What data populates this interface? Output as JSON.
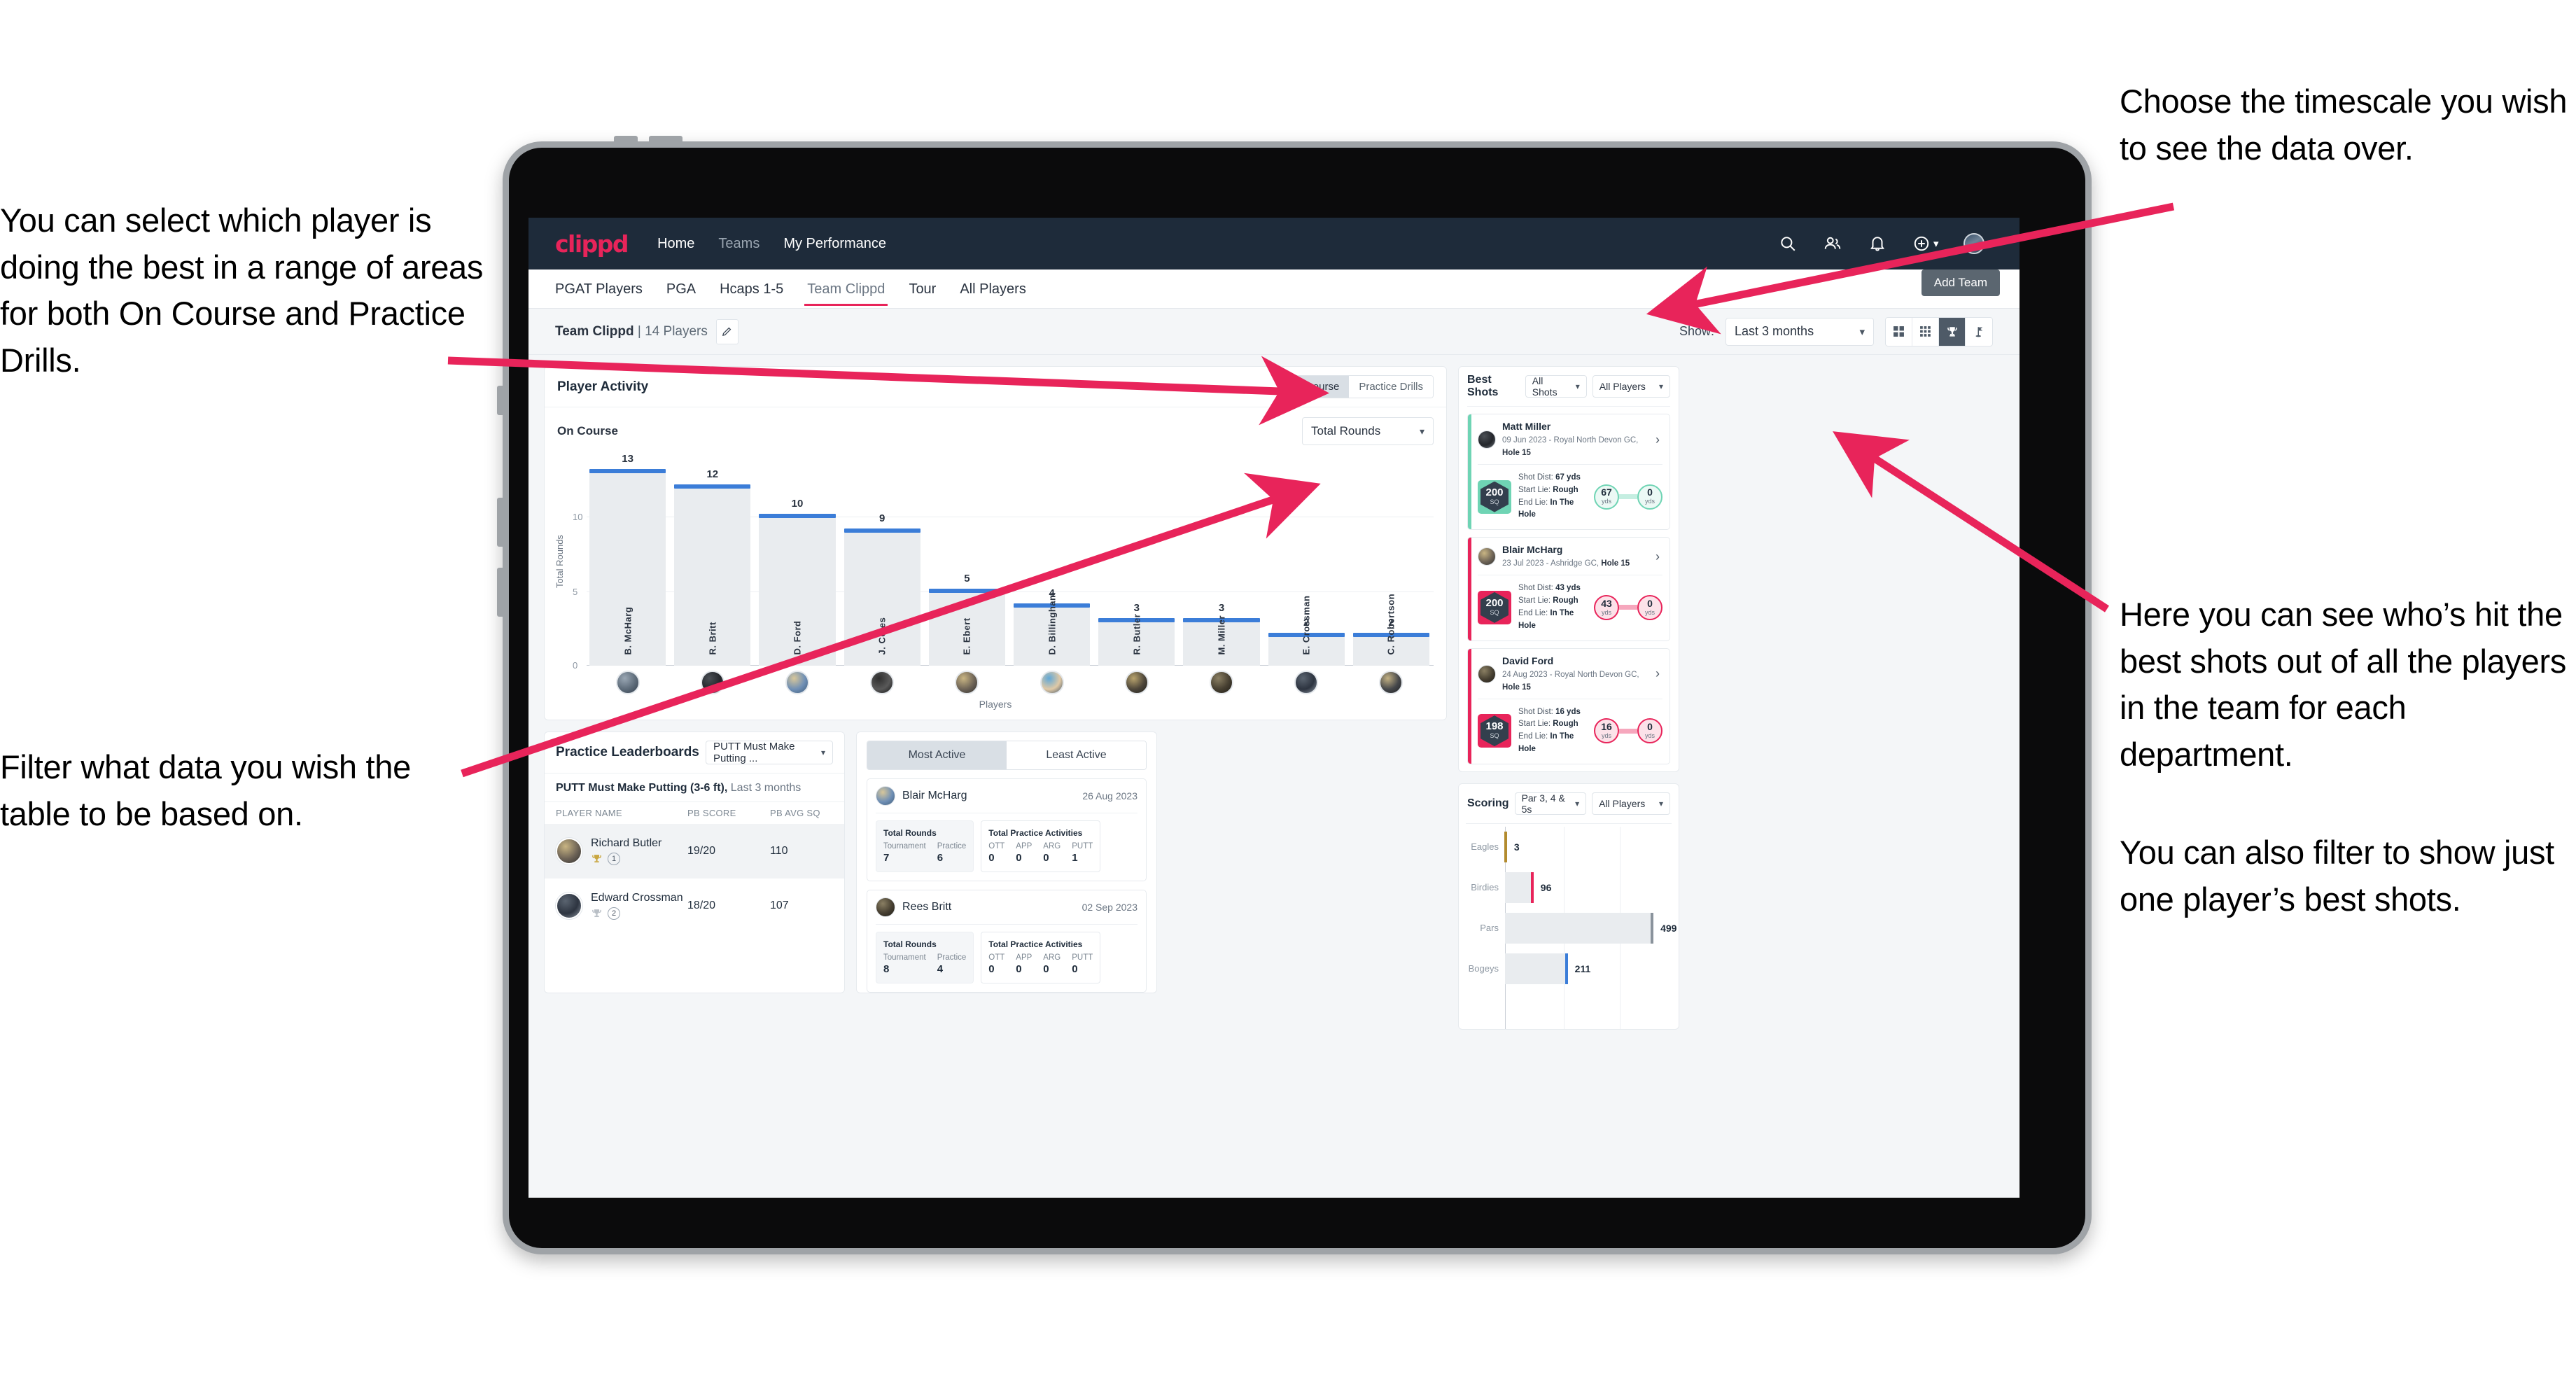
{
  "annotations": {
    "left_top": "You can select which player is doing the best in a range of areas for both On Course and Practice Drills.",
    "left_bottom": "Filter what data you wish the table to be based on.",
    "right_top": "Choose the timescale you wish to see the data over.",
    "right_middle": "Here you can see who’s hit the best shots out of all the players in the team for each department.",
    "right_bottom": "You can also filter to show just one player’s best shots."
  },
  "topnav": {
    "logo": "clippd",
    "links": [
      {
        "label": "Home",
        "active": true
      },
      {
        "label": "Teams",
        "active": false
      },
      {
        "label": "My Performance",
        "active": true
      }
    ],
    "icons": [
      "search-icon",
      "people-icon",
      "bell-icon",
      "plus-circle-icon",
      "avatar"
    ]
  },
  "tabs": [
    {
      "label": "PGAT Players",
      "active": false
    },
    {
      "label": "PGA",
      "active": false
    },
    {
      "label": "Hcaps 1-5",
      "active": false
    },
    {
      "label": "Team Clippd",
      "active": true
    },
    {
      "label": "Tour",
      "active": false
    },
    {
      "label": "All Players",
      "active": false
    }
  ],
  "tooltip": {
    "add_team": "Add Team"
  },
  "toolbar": {
    "team_name": "Team Clippd",
    "separator": "|",
    "player_count": "14 Players",
    "edit_icon": "pencil-icon",
    "show_label": "Show:",
    "timescale_value": "Last 3 months",
    "view_icons": [
      {
        "name": "grid-2x2-icon",
        "active": false
      },
      {
        "name": "grid-3x3-icon",
        "active": false
      },
      {
        "name": "trophy-icon",
        "active": true
      },
      {
        "name": "golf-flag-icon",
        "active": false
      }
    ]
  },
  "player_activity": {
    "title": "Player Activity",
    "segments": [
      {
        "label": "On Course",
        "active": true
      },
      {
        "label": "Practice Drills",
        "active": false
      }
    ],
    "sub_label": "On Course",
    "metric_value": "Total Rounds"
  },
  "chart_data": [
    {
      "type": "bar",
      "title": "Player Activity - On Course",
      "xlabel": "Players",
      "ylabel": "Total Rounds",
      "categories": [
        "B. McHarg",
        "R. Britt",
        "D. Ford",
        "J. Coles",
        "E. Ebert",
        "D. Billingham",
        "R. Butler",
        "M. Miller",
        "E. Crossman",
        "C. Robertson"
      ],
      "values": [
        13,
        12,
        10,
        9,
        5,
        4,
        3,
        3,
        2,
        2
      ],
      "yticks": [
        0,
        5,
        10
      ],
      "ylim": [
        0,
        14
      ],
      "grid": true,
      "bar_color": "#e9ecef",
      "cap_color": "#3b7dd8"
    },
    {
      "type": "bar",
      "orientation": "horizontal",
      "title": "Scoring",
      "categories": [
        "Eagles",
        "Birdies",
        "Pars",
        "Bogeys"
      ],
      "values": [
        3,
        96,
        499,
        211
      ],
      "xlim": [
        0,
        560
      ],
      "grid": true,
      "tip_colors": [
        "#b38b2e",
        "#e8245a",
        "#8a939c",
        "#3b7dd8"
      ],
      "bar_color": "#e9ecef"
    }
  ],
  "best_shots": {
    "title": "Best Shots",
    "shot_filter": "All Shots",
    "player_filter": "All Players",
    "cards": [
      {
        "player": "Matt Miller",
        "meta_prefix": "09 Jun 2023 - Royal North Devon GC, ",
        "meta_hole": "Hole 15",
        "badge_value": "200",
        "badge_unit": "SQ",
        "badge_color": "#6fd4b4",
        "accent": "#6fd4b4",
        "shot_dist_label": "Shot Dist: ",
        "shot_dist_value": "67 yds",
        "start_lie_label": "Start Lie: ",
        "start_lie_value": "Rough",
        "end_lie_label": "End Lie: ",
        "end_lie_value": "In The Hole",
        "from_value": "67",
        "from_unit": "yds",
        "to_value": "0",
        "to_unit": "yds"
      },
      {
        "player": "Blair McHarg",
        "meta_prefix": "23 Jul 2023 - Ashridge GC, ",
        "meta_hole": "Hole 15",
        "badge_value": "200",
        "badge_unit": "SQ",
        "badge_color": "#e8245a",
        "accent": "#e8245a",
        "shot_dist_label": "Shot Dist: ",
        "shot_dist_value": "43 yds",
        "start_lie_label": "Start Lie: ",
        "start_lie_value": "Rough",
        "end_lie_label": "End Lie: ",
        "end_lie_value": "In The Hole",
        "from_value": "43",
        "from_unit": "yds",
        "to_value": "0",
        "to_unit": "yds"
      },
      {
        "player": "David Ford",
        "meta_prefix": "24 Aug 2023 - Royal North Devon GC, ",
        "meta_hole": "Hole 15",
        "badge_value": "198",
        "badge_unit": "SQ",
        "badge_color": "#e8245a",
        "accent": "#e8245a",
        "shot_dist_label": "Shot Dist: ",
        "shot_dist_value": "16 yds",
        "start_lie_label": "Start Lie: ",
        "start_lie_value": "Rough",
        "end_lie_label": "End Lie: ",
        "end_lie_value": "In The Hole",
        "from_value": "16",
        "from_unit": "yds",
        "to_value": "0",
        "to_unit": "yds"
      }
    ]
  },
  "practice_leaderboards": {
    "title": "Practice Leaderboards",
    "drill_select": "PUTT Must Make Putting ...",
    "sub_bold": "PUTT Must Make Putting (3-6 ft),",
    "sub_light": " Last 3 months",
    "headers": [
      "PLAYER NAME",
      "PB SCORE",
      "PB AVG SQ"
    ],
    "rows": [
      {
        "name": "Richard Butler",
        "medal": "gold",
        "rank": "1",
        "pb_score": "19/20",
        "pb_avg_sq": "110",
        "highlight": true
      },
      {
        "name": "Edward Crossman",
        "medal": "silver",
        "rank": "2",
        "pb_score": "18/20",
        "pb_avg_sq": "107",
        "highlight": false
      }
    ]
  },
  "activity": {
    "tabs": [
      {
        "label": "Most Active",
        "active": true
      },
      {
        "label": "Least Active",
        "active": false
      }
    ],
    "cards": [
      {
        "player": "Blair McHarg",
        "date": "26 Aug 2023",
        "rounds_title": "Total Rounds",
        "rounds": [
          {
            "k": "Tournament",
            "v": "7"
          },
          {
            "k": "Practice",
            "v": "6"
          }
        ],
        "practice_title": "Total Practice Activities",
        "practice": [
          {
            "k": "OTT",
            "v": "0"
          },
          {
            "k": "APP",
            "v": "0"
          },
          {
            "k": "ARG",
            "v": "0"
          },
          {
            "k": "PUTT",
            "v": "1"
          }
        ]
      },
      {
        "player": "Rees Britt",
        "date": "02 Sep 2023",
        "rounds_title": "Total Rounds",
        "rounds": [
          {
            "k": "Tournament",
            "v": "8"
          },
          {
            "k": "Practice",
            "v": "4"
          }
        ],
        "practice_title": "Total Practice Activities",
        "practice": [
          {
            "k": "OTT",
            "v": "0"
          },
          {
            "k": "APP",
            "v": "0"
          },
          {
            "k": "ARG",
            "v": "0"
          },
          {
            "k": "PUTT",
            "v": "0"
          }
        ]
      }
    ]
  },
  "scoring": {
    "title": "Scoring",
    "par_filter": "Par 3, 4 & 5s",
    "player_filter": "All Players"
  },
  "colors": {
    "brand_pink": "#e8245a",
    "nav_dark": "#1e2b3a",
    "bar_blue": "#3b7dd8",
    "teal": "#6fd4b4"
  }
}
